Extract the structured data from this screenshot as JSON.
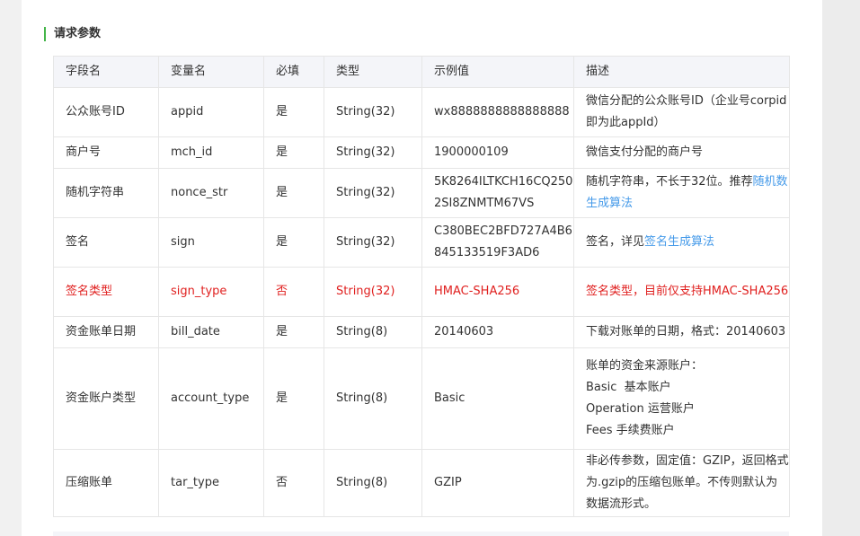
{
  "section_title": "请求参数",
  "table": {
    "headers": [
      "字段名",
      "变量名",
      "必填",
      "类型",
      "示例值",
      "描述"
    ],
    "rows": [
      {
        "field": "公众账号ID",
        "var": "appid",
        "required": "是",
        "type": "String(32)",
        "example": "wx8888888888888888",
        "desc": "微信分配的公众账号ID（企业号corpid即为此appId）"
      },
      {
        "field": "商户号",
        "var": "mch_id",
        "required": "是",
        "type": "String(32)",
        "example": "1900000109",
        "desc": "微信支付分配的商户号"
      },
      {
        "field": "随机字符串",
        "var": "nonce_str",
        "required": "是",
        "type": "String(32)",
        "example": "5K8264ILTKCH16CQ2502SI8ZNMTM67VS",
        "desc": "随机字符串，不长于32位。推荐",
        "desc_link": "随机数生成算法"
      },
      {
        "field": "签名",
        "var": "sign",
        "required": "是",
        "type": "String(32)",
        "example": "C380BEC2BFD727A4B6845133519F3AD6",
        "desc": "签名，详见",
        "desc_link": "签名生成算法"
      },
      {
        "field": "签名类型",
        "var": "sign_type",
        "required": "否",
        "type": "String(32)",
        "example": "HMAC-SHA256",
        "desc": "签名类型，目前仅支持HMAC-SHA256"
      },
      {
        "field": "资金账单日期",
        "var": "bill_date",
        "required": "是",
        "type": "String(8)",
        "example": "20140603",
        "desc": "下载对账单的日期，格式：20140603"
      },
      {
        "field": "资金账户类型",
        "var": "account_type",
        "required": "是",
        "type": "String(8)",
        "example": "Basic",
        "desc_lines": [
          "账单的资金来源账户：",
          "Basic  基本账户",
          "Operation 运营账户",
          "Fees 手续费账户"
        ]
      },
      {
        "field": "压缩账单",
        "var": "tar_type",
        "required": "否",
        "type": "String(8)",
        "example": "GZIP",
        "desc": "非必传参数，固定值：GZIP，返回格式为.gzip的压缩包账单。不传则默认为数据流形式。"
      }
    ]
  },
  "colors": {
    "accent": "#44b549",
    "highlight": "#e0201f",
    "link": "#459ae9"
  }
}
